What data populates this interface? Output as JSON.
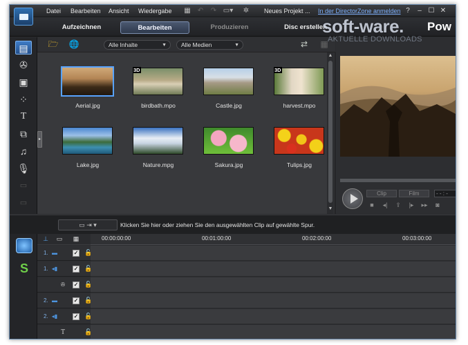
{
  "menu": [
    "Datei",
    "Bearbeiten",
    "Ansicht",
    "Wiedergabe"
  ],
  "project_title": "Neues Projekt ...",
  "director_zone_link": "In der DirectorZone anmelden",
  "window_buttons": [
    "?",
    "–",
    "☐",
    "✕"
  ],
  "mode_tabs": [
    {
      "label": "Aufzeichnen",
      "active": false
    },
    {
      "label": "Bearbeiten",
      "active": true
    },
    {
      "label": "Produzieren",
      "active": false
    },
    {
      "label": "Disc erstellen",
      "active": false
    }
  ],
  "watermark": {
    "main": "soft-ware.",
    "suffix": "Pow",
    "sub": "AKTUELLE DOWNLOADS"
  },
  "library": {
    "filter_content": "Alle Inhalte",
    "filter_media": "Alle Medien",
    "items": [
      {
        "label": "Aerial.jpg",
        "is3d": false,
        "selected": true
      },
      {
        "label": "birdbath.mpo",
        "is3d": true,
        "selected": false
      },
      {
        "label": "Castle.jpg",
        "is3d": false,
        "selected": false
      },
      {
        "label": "harvest.mpo",
        "is3d": true,
        "selected": false
      },
      {
        "label": "Lake.jpg",
        "is3d": false,
        "selected": false
      },
      {
        "label": "Nature.mpg",
        "is3d": false,
        "selected": false
      },
      {
        "label": "Sakura.jpg",
        "is3d": false,
        "selected": false
      },
      {
        "label": "Tulips.jpg",
        "is3d": false,
        "selected": false
      }
    ],
    "badge_3d": "3D"
  },
  "preview": {
    "mode_clip": "Clip",
    "mode_film": "Film",
    "timecode": "- - : -"
  },
  "status_hint": "Klicken Sie hier oder ziehen Sie den ausgewählten Clip auf gewählte Spur.",
  "timeline": {
    "ruler_labels": [
      "00:00:00:00",
      "00:01:00:00",
      "00:02:00:00",
      "00:03:00:00"
    ],
    "tracks": [
      {
        "num": "1.",
        "type": "video"
      },
      {
        "num": "1.",
        "type": "audio"
      },
      {
        "num": "",
        "type": "fx"
      },
      {
        "num": "2.",
        "type": "video"
      },
      {
        "num": "2.",
        "type": "audio"
      },
      {
        "num": "",
        "type": "title"
      }
    ]
  },
  "colors": {
    "accent": "#58a3ff",
    "background": "#2a2b2e",
    "link": "#7fb2ff"
  }
}
